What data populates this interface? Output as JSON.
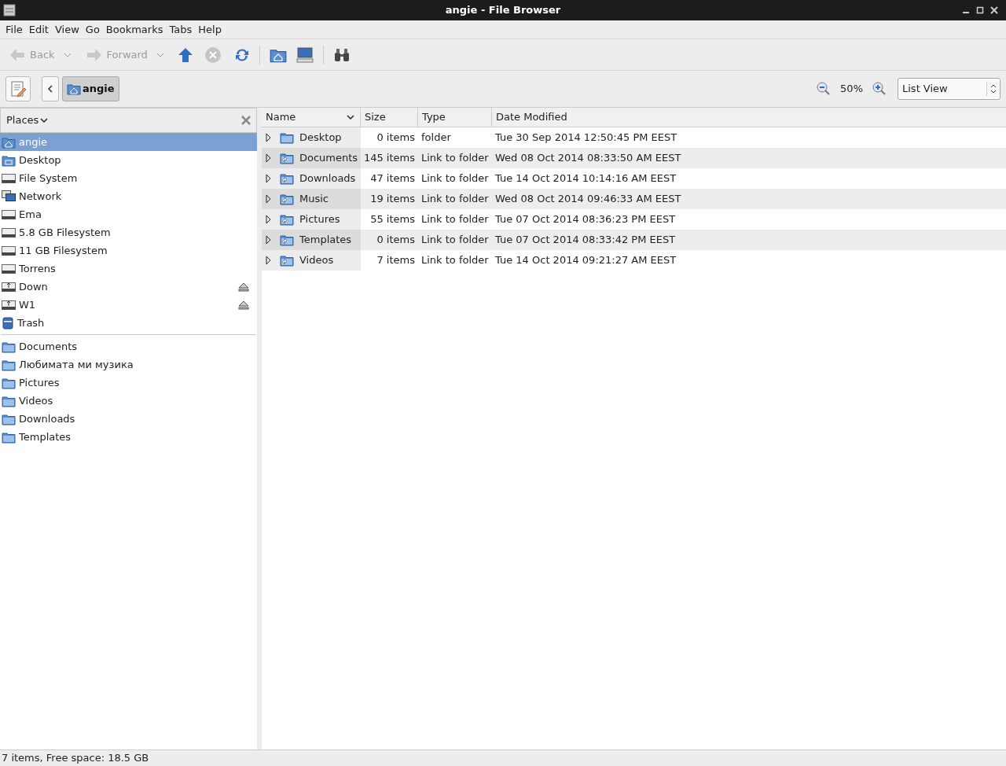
{
  "window": {
    "title": "angie - File Browser"
  },
  "menu": [
    "File",
    "Edit",
    "View",
    "Go",
    "Bookmarks",
    "Tabs",
    "Help"
  ],
  "toolbar": {
    "back": {
      "label": "Back",
      "disabled": true
    },
    "forward": {
      "label": "Forward",
      "disabled": true
    },
    "stop": {
      "disabled": true
    }
  },
  "location": {
    "crumb": "angie",
    "zoom": "50%",
    "view": "List View"
  },
  "sidebar": {
    "title": "Places",
    "devices": [
      {
        "kind": "home",
        "label": "angie",
        "selected": true,
        "eject": false
      },
      {
        "kind": "desktop",
        "label": "Desktop",
        "selected": false,
        "eject": false
      },
      {
        "kind": "drive",
        "label": "File System",
        "selected": false,
        "eject": false
      },
      {
        "kind": "network",
        "label": "Network",
        "selected": false,
        "eject": false
      },
      {
        "kind": "drive",
        "label": "Ema",
        "selected": false,
        "eject": false
      },
      {
        "kind": "drive",
        "label": "5.8 GB Filesystem",
        "selected": false,
        "eject": false
      },
      {
        "kind": "drive",
        "label": "11 GB Filesystem",
        "selected": false,
        "eject": false
      },
      {
        "kind": "drive",
        "label": "Torrens",
        "selected": false,
        "eject": false
      },
      {
        "kind": "usb",
        "label": "Down",
        "selected": false,
        "eject": true
      },
      {
        "kind": "usb",
        "label": "W1",
        "selected": false,
        "eject": true
      },
      {
        "kind": "trash",
        "label": "Trash",
        "selected": false,
        "eject": false
      }
    ],
    "bookmarks": [
      {
        "kind": "folder",
        "label": "Documents",
        "selected": false
      },
      {
        "kind": "folder",
        "label": "Любимата ми музика",
        "selected": false
      },
      {
        "kind": "folder",
        "label": "Pictures",
        "selected": false
      },
      {
        "kind": "folder",
        "label": "Videos",
        "selected": false
      },
      {
        "kind": "folder",
        "label": "Downloads",
        "selected": false
      },
      {
        "kind": "folder",
        "label": "Templates",
        "selected": false
      }
    ]
  },
  "table": {
    "columns": [
      "Name",
      "Size",
      "Type",
      "Date Modified"
    ],
    "rows": [
      {
        "kind": "folder",
        "name": "Desktop",
        "size": "0 items",
        "type": "folder",
        "date": "Tue 30 Sep 2014 12:50:45 PM EEST",
        "expanded": false
      },
      {
        "kind": "link",
        "name": "Documents",
        "size": "145 items",
        "type": "Link to folder",
        "date": "Wed 08 Oct 2014 08:33:50 AM EEST",
        "expanded": false
      },
      {
        "kind": "link",
        "name": "Downloads",
        "size": "47 items",
        "type": "Link to folder",
        "date": "Tue 14 Oct 2014 10:14:16 AM EEST",
        "expanded": false
      },
      {
        "kind": "link",
        "name": "Music",
        "size": "19 items",
        "type": "Link to folder",
        "date": "Wed 08 Oct 2014 09:46:33 AM EEST",
        "expanded": false
      },
      {
        "kind": "link",
        "name": "Pictures",
        "size": "55 items",
        "type": "Link to folder",
        "date": "Tue 07 Oct 2014 08:36:23 PM EEST",
        "expanded": false
      },
      {
        "kind": "link",
        "name": "Templates",
        "size": "0 items",
        "type": "Link to folder",
        "date": "Tue 07 Oct 2014 08:33:42 PM EEST",
        "expanded": false
      },
      {
        "kind": "link",
        "name": "Videos",
        "size": "7 items",
        "type": "Link to folder",
        "date": "Tue 14 Oct 2014 09:21:27 AM EEST",
        "expanded": false
      }
    ]
  },
  "status_bar": "7 items, Free space: 18.5 GB"
}
